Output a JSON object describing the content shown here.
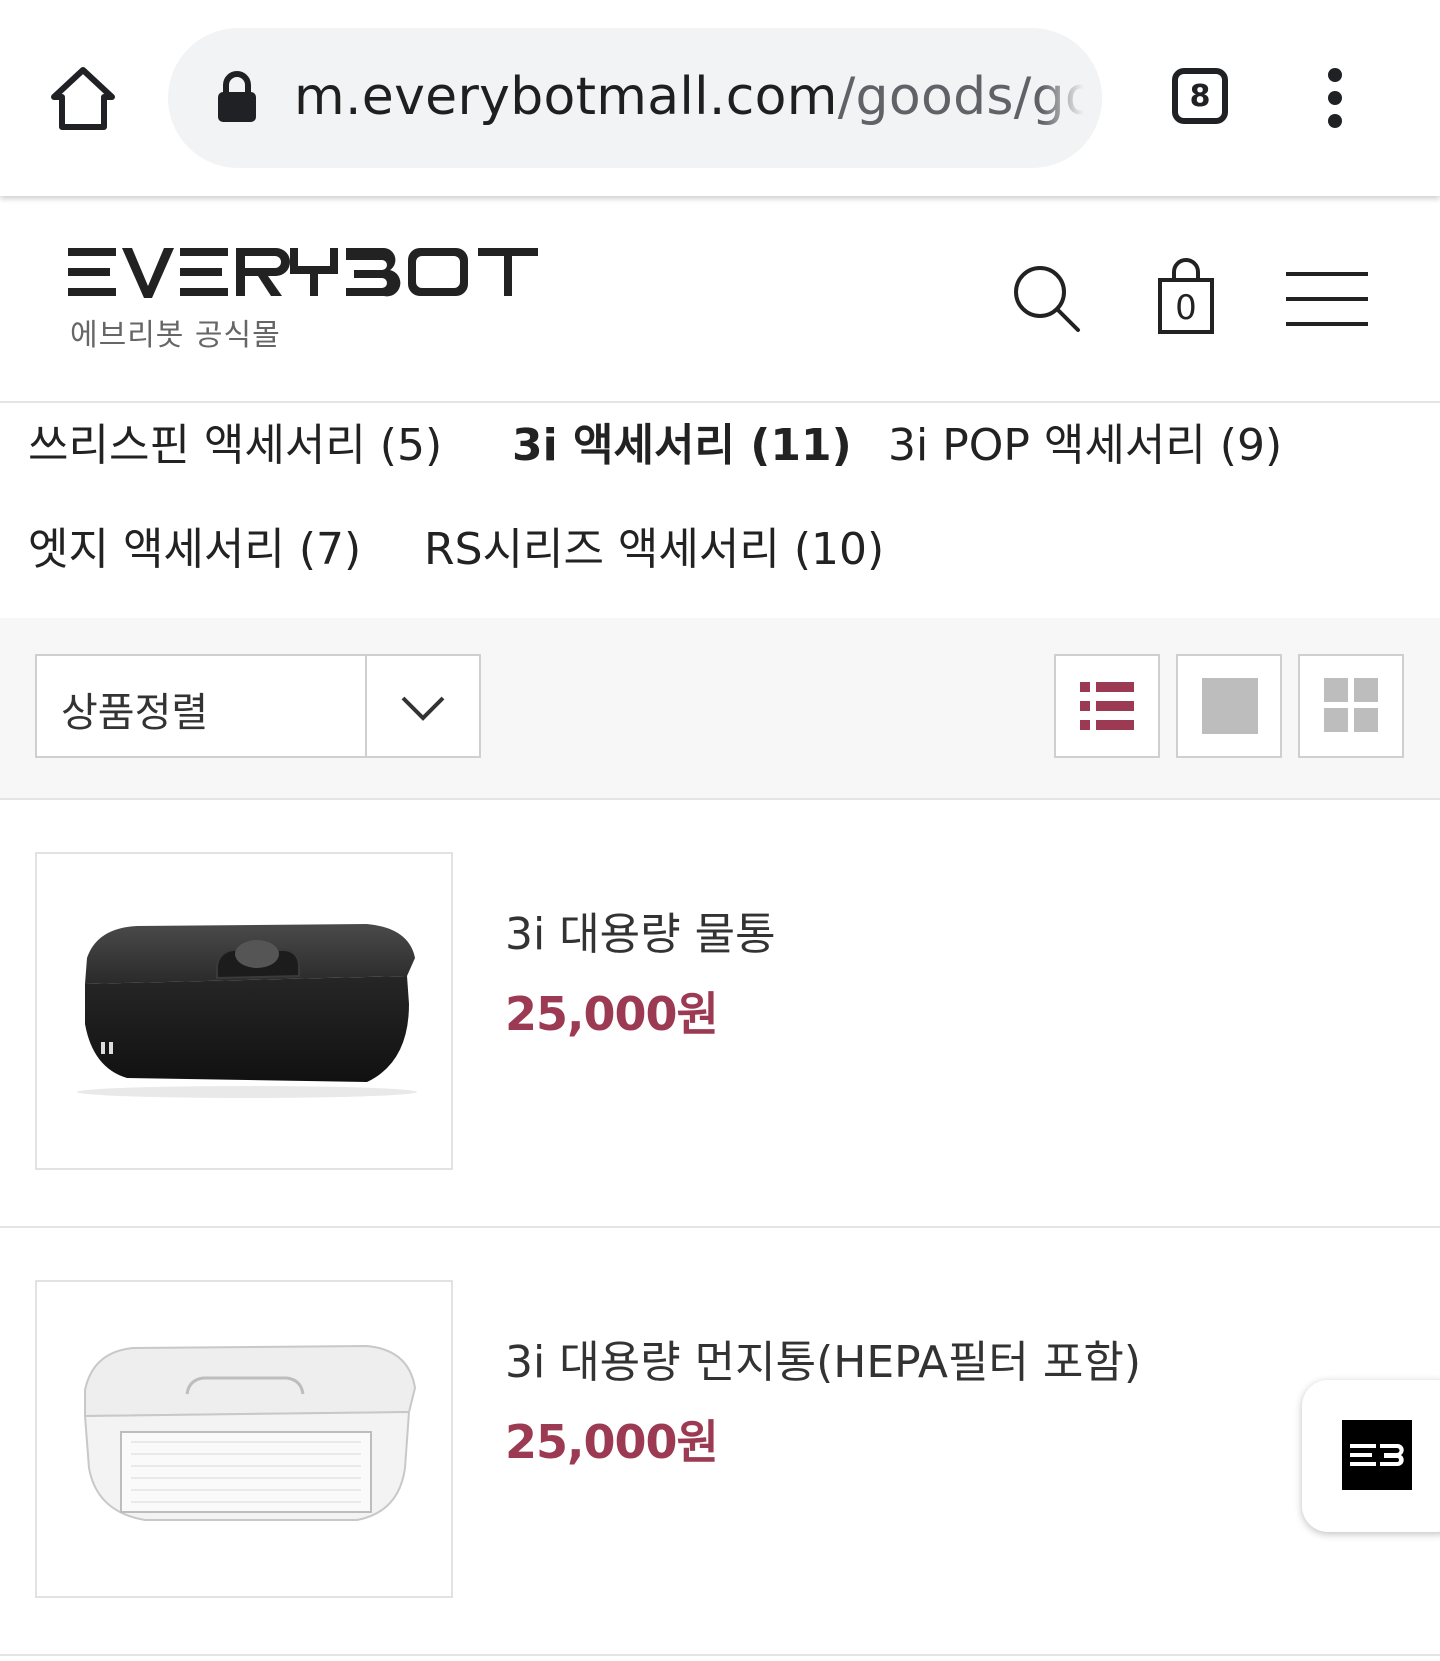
{
  "browser": {
    "url_domain": "m.everybotmall.com",
    "url_path": "/goods/go",
    "tab_count": "8"
  },
  "header": {
    "logo_text": "EVERYBOT",
    "logo_subtitle": "에브리봇 공식몰",
    "cart_count": "0"
  },
  "categories": [
    {
      "label": "쓰리스핀 액세서리 (5)",
      "active": false
    },
    {
      "label": "3i 액세서리 (11)",
      "active": true
    },
    {
      "label": "3i POP 액세서리 (9)",
      "active": false
    },
    {
      "label": "엣지 액세서리 (7)",
      "active": false
    },
    {
      "label": "RS시리즈 액세서리 (10)",
      "active": false
    }
  ],
  "sort": {
    "label": "상품정렬"
  },
  "view_modes": [
    "list-view",
    "single-view",
    "grid-view"
  ],
  "products": [
    {
      "name": "3i 대용량 물통",
      "price": "25,000원"
    },
    {
      "name": "3i 대용량 먼지통(HEPA필터 포함)",
      "price": "25,000원"
    }
  ],
  "colors": {
    "accent": "#9b3a52",
    "view_inactive": "#bdbdbd"
  }
}
